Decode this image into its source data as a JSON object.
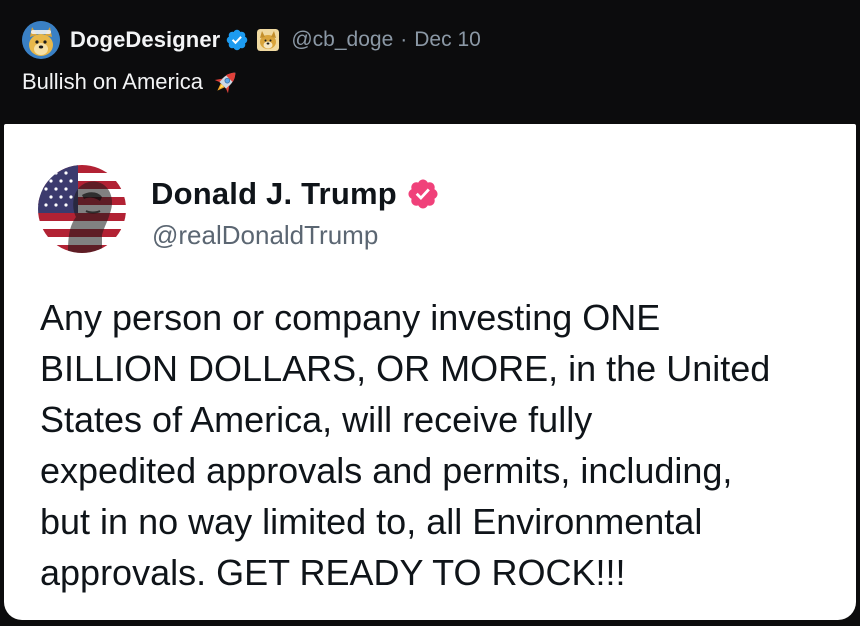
{
  "outer_tweet": {
    "author_name": "DogeDesigner",
    "handle": "@cb_doge",
    "separator": "·",
    "date": "Dec 10",
    "text": "Bullish on America",
    "author_avatar_icon": "doge-avatar-icon",
    "verified_icon": "verified-badge-icon",
    "affiliate_badge_icon": "doge-affiliate-badge-icon",
    "emoji_icon": "rocket-icon"
  },
  "quoted_tweet": {
    "author_name": "Donald J. Trump",
    "handle": "@realDonaldTrump",
    "author_avatar_icon": "flag-portrait-avatar-icon",
    "verified_icon": "verified-badge-icon",
    "text": "Any person or company investing ONE\nBILLION DOLLARS, OR MORE, in the United\nStates of America, will receive fully\nexpedited approvals and permits, including,\nbut in no way limited to, all Environmental\napprovals. GET READY TO ROCK!!!"
  },
  "colors": {
    "background": "#0c0c0d",
    "verified_blue": "#1d9bf0",
    "verified_pink": "#f0417a",
    "muted_text": "#8b98a5",
    "card_background": "#ffffff"
  }
}
